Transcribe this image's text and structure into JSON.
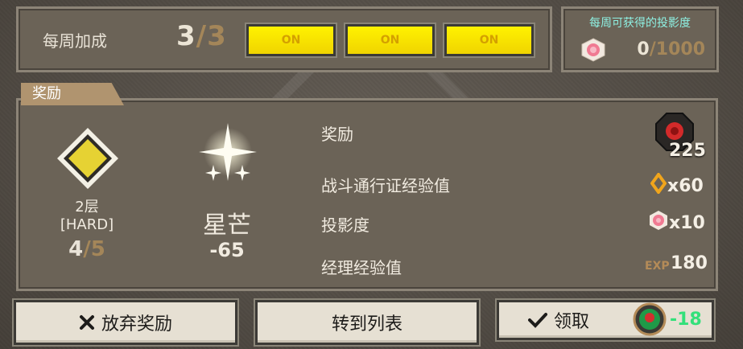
{
  "weekly_bonus": {
    "label": "每周加成",
    "count_current": "3",
    "count_separator": "/",
    "count_max": "3",
    "toggles": [
      "ON",
      "ON",
      "ON"
    ]
  },
  "projection_weekly": {
    "title": "每周可获得的投影度",
    "current": "0",
    "max": "/1000",
    "icon": "pink-flower-icon"
  },
  "reward_panel": {
    "tab_label": "奖励",
    "stage": {
      "floor": "2层",
      "difficulty": "[HARD]",
      "progress_current": "4",
      "progress_max": "/5",
      "icon": "yellow-diamond-icon"
    },
    "starlight": {
      "name": "星芒",
      "cost": "-65",
      "icon": "sparkle-star-icon"
    },
    "rows": {
      "reward_label": "奖励",
      "reward_count": "225",
      "pass_exp_label": "战斗通行证经验值",
      "pass_exp_value": "x60",
      "projection_label": "投影度",
      "projection_value": "x10",
      "manager_exp_label": "经理经验值",
      "manager_exp_tag": "EXP",
      "manager_exp_value": "180"
    }
  },
  "actions": {
    "abandon": "放弃奖励",
    "to_list": "转到列表",
    "claim": "领取",
    "claim_cost": "-18"
  },
  "colors": {
    "on_yellow": "#fff200",
    "cyan_title": "#8ef0e2",
    "green_cost": "#33e07a",
    "muted_tan": "#a48659"
  }
}
